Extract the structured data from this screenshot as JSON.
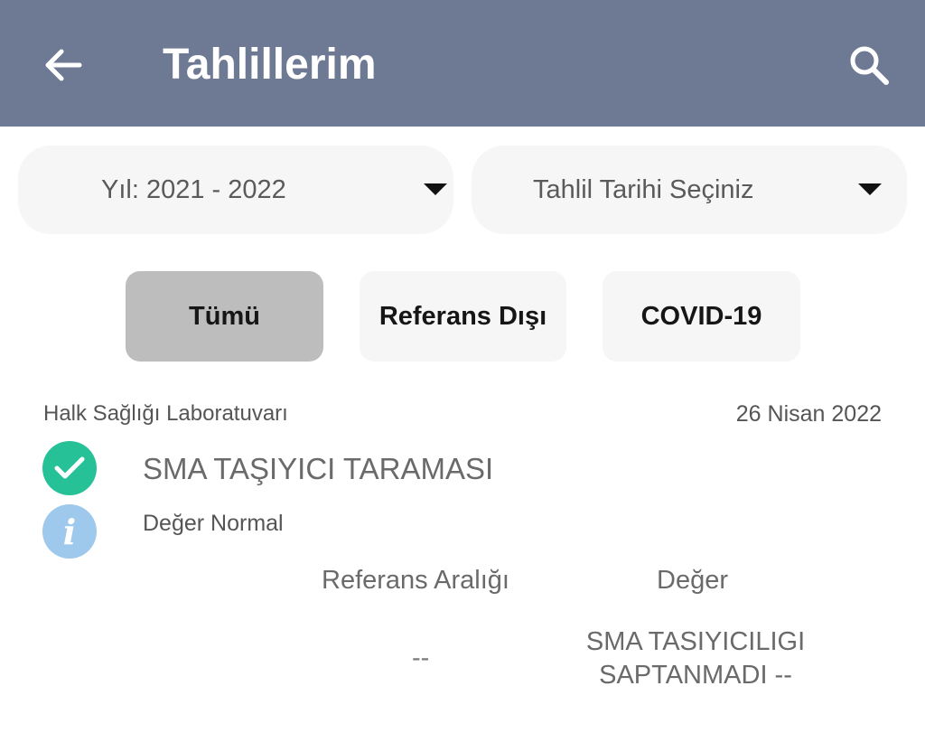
{
  "appbar": {
    "title": "Tahlillerim",
    "back_icon": "arrow-left-icon",
    "search_icon": "search-icon",
    "background_color": "#6e7a94"
  },
  "filters": {
    "year_dropdown": {
      "value": "Yıl: 2021 - 2022",
      "icon": "caret-down-icon"
    },
    "date_dropdown": {
      "value": "Tahlil Tarihi Seçiniz",
      "icon": "caret-down-icon"
    }
  },
  "chips": [
    {
      "label": "Tümü",
      "selected": true
    },
    {
      "label": "Referans Dışı",
      "selected": false
    },
    {
      "label": "COVID-19",
      "selected": false
    }
  ],
  "result": {
    "laboratory": "Halk Sağlığı Laboratuvarı",
    "date": "26 Nisan 2022",
    "status_icon": "check-circle-icon",
    "status_icon_color": "#26c196",
    "info_icon": "info-icon",
    "info_icon_color": "#9ec8ec",
    "test_name": "SMA TAŞIYICI TARAMASI",
    "status_text": "Değer Normal",
    "columns": {
      "reference": "Referans Aralığı",
      "value": "Değer"
    },
    "row": {
      "reference": "--",
      "value_line1": "SMA TASIYICILIGI",
      "value_line2": "SAPTANMADI --"
    }
  }
}
